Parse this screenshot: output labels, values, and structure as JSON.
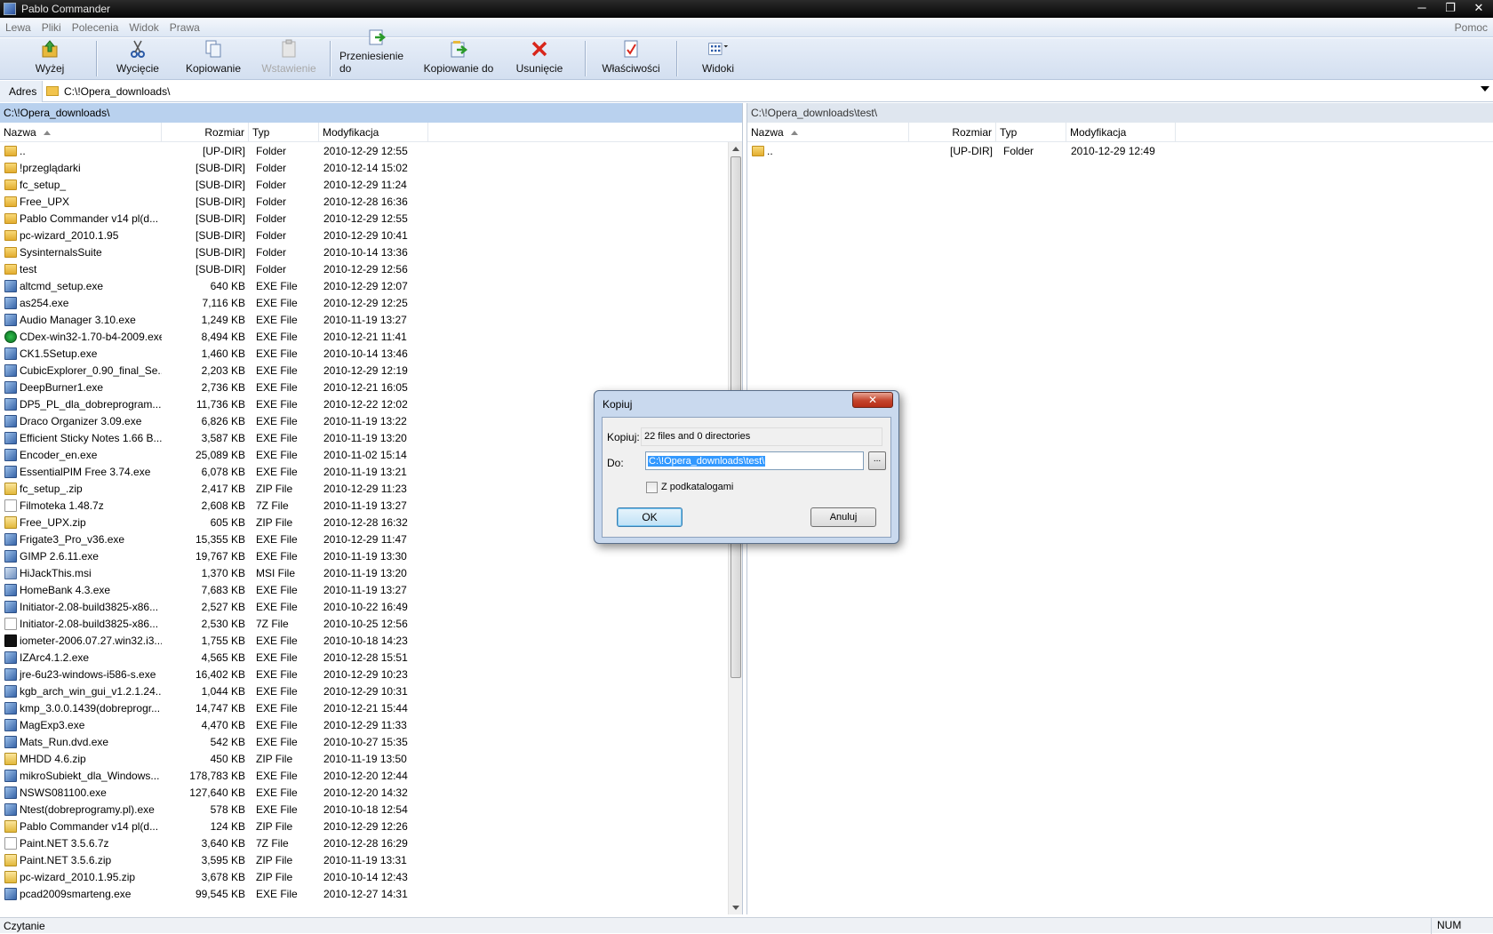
{
  "window": {
    "title": "Pablo Commander",
    "controls": [
      "─",
      "❐",
      "✕"
    ]
  },
  "menu": {
    "items": [
      "Lewa",
      "Pliki",
      "Polecenia",
      "Widok",
      "Prawa"
    ],
    "help": "Pomoc"
  },
  "toolbar": {
    "up": "Wyżej",
    "cut": "Wycięcie",
    "copy": "Kopiowanie",
    "paste": "Wstawienie",
    "move_to": "Przeniesienie do",
    "copy_to": "Kopiowanie do",
    "delete": "Usunięcie",
    "properties": "Właściwości",
    "views": "Widoki"
  },
  "address": {
    "label": "Adres",
    "value": "C:\\!Opera_downloads\\"
  },
  "left_panel": {
    "path": "C:\\!Opera_downloads\\",
    "columns": {
      "name": "Nazwa",
      "size": "Rozmiar",
      "type": "Typ",
      "modified": "Modyfikacja"
    },
    "rows": [
      {
        "icon": "folder",
        "name": "..",
        "size": "[UP-DIR]",
        "type": "Folder",
        "modified": "2010-12-29 12:55"
      },
      {
        "icon": "folder",
        "name": "!przeglądarki",
        "size": "[SUB-DIR]",
        "type": "Folder",
        "modified": "2010-12-14 15:02"
      },
      {
        "icon": "folder",
        "name": "fc_setup_",
        "size": "[SUB-DIR]",
        "type": "Folder",
        "modified": "2010-12-29 11:24"
      },
      {
        "icon": "folder",
        "name": "Free_UPX",
        "size": "[SUB-DIR]",
        "type": "Folder",
        "modified": "2010-12-28 16:36"
      },
      {
        "icon": "folder",
        "name": "Pablo Commander v14 pl(d...",
        "size": "[SUB-DIR]",
        "type": "Folder",
        "modified": "2010-12-29 12:55"
      },
      {
        "icon": "folder",
        "name": "pc-wizard_2010.1.95",
        "size": "[SUB-DIR]",
        "type": "Folder",
        "modified": "2010-12-29 10:41"
      },
      {
        "icon": "folder",
        "name": "SysinternalsSuite",
        "size": "[SUB-DIR]",
        "type": "Folder",
        "modified": "2010-10-14 13:36"
      },
      {
        "icon": "folder",
        "name": "test",
        "size": "[SUB-DIR]",
        "type": "Folder",
        "modified": "2010-12-29 12:56"
      },
      {
        "icon": "exe",
        "name": "altcmd_setup.exe",
        "size": "640 KB",
        "type": "EXE File",
        "modified": "2010-12-29 12:07"
      },
      {
        "icon": "exe",
        "name": "as254.exe",
        "size": "7,116 KB",
        "type": "EXE File",
        "modified": "2010-12-29 12:25"
      },
      {
        "icon": "exe",
        "name": "Audio Manager 3.10.exe",
        "size": "1,249 KB",
        "type": "EXE File",
        "modified": "2010-11-19 13:27"
      },
      {
        "icon": "green",
        "name": "CDex-win32-1.70-b4-2009.exe",
        "size": "8,494 KB",
        "type": "EXE File",
        "modified": "2010-12-21 11:41"
      },
      {
        "icon": "exe",
        "name": "CK1.5Setup.exe",
        "size": "1,460 KB",
        "type": "EXE File",
        "modified": "2010-10-14 13:46"
      },
      {
        "icon": "exe",
        "name": "CubicExplorer_0.90_final_Se...",
        "size": "2,203 KB",
        "type": "EXE File",
        "modified": "2010-12-29 12:19"
      },
      {
        "icon": "exe",
        "name": "DeepBurner1.exe",
        "size": "2,736 KB",
        "type": "EXE File",
        "modified": "2010-12-21 16:05"
      },
      {
        "icon": "exe",
        "name": "DP5_PL_dla_dobreprogram...",
        "size": "11,736 KB",
        "type": "EXE File",
        "modified": "2010-12-22 12:02"
      },
      {
        "icon": "exe",
        "name": "Draco Organizer 3.09.exe",
        "size": "6,826 KB",
        "type": "EXE File",
        "modified": "2010-11-19 13:22"
      },
      {
        "icon": "exe",
        "name": "Efficient Sticky Notes 1.66 B...",
        "size": "3,587 KB",
        "type": "EXE File",
        "modified": "2010-11-19 13:20"
      },
      {
        "icon": "exe",
        "name": "Encoder_en.exe",
        "size": "25,089 KB",
        "type": "EXE File",
        "modified": "2010-11-02 15:14"
      },
      {
        "icon": "exe",
        "name": "EssentialPIM Free 3.74.exe",
        "size": "6,078 KB",
        "type": "EXE File",
        "modified": "2010-11-19 13:21"
      },
      {
        "icon": "zip",
        "name": "fc_setup_.zip",
        "size": "2,417 KB",
        "type": "ZIP File",
        "modified": "2010-12-29 11:23"
      },
      {
        "icon": "file",
        "name": "Filmoteka 1.48.7z",
        "size": "2,608 KB",
        "type": "7Z File",
        "modified": "2010-11-19 13:27"
      },
      {
        "icon": "zip",
        "name": "Free_UPX.zip",
        "size": "605 KB",
        "type": "ZIP File",
        "modified": "2010-12-28 16:32"
      },
      {
        "icon": "exe",
        "name": "Frigate3_Pro_v36.exe",
        "size": "15,355 KB",
        "type": "EXE File",
        "modified": "2010-12-29 11:47"
      },
      {
        "icon": "exe",
        "name": "GIMP 2.6.11.exe",
        "size": "19,767 KB",
        "type": "EXE File",
        "modified": "2010-11-19 13:30"
      },
      {
        "icon": "msi",
        "name": "HiJackThis.msi",
        "size": "1,370 KB",
        "type": "MSI File",
        "modified": "2010-11-19 13:20"
      },
      {
        "icon": "exe",
        "name": "HomeBank 4.3.exe",
        "size": "7,683 KB",
        "type": "EXE File",
        "modified": "2010-11-19 13:27"
      },
      {
        "icon": "exe",
        "name": "Initiator-2.08-build3825-x86...",
        "size": "2,527 KB",
        "type": "EXE File",
        "modified": "2010-10-22 16:49"
      },
      {
        "icon": "file",
        "name": "Initiator-2.08-build3825-x86...",
        "size": "2,530 KB",
        "type": "7Z File",
        "modified": "2010-10-25 12:56"
      },
      {
        "icon": "dark",
        "name": "iometer-2006.07.27.win32.i3...",
        "size": "1,755 KB",
        "type": "EXE File",
        "modified": "2010-10-18 14:23"
      },
      {
        "icon": "exe",
        "name": "IZArc4.1.2.exe",
        "size": "4,565 KB",
        "type": "EXE File",
        "modified": "2010-12-28 15:51"
      },
      {
        "icon": "exe",
        "name": "jre-6u23-windows-i586-s.exe",
        "size": "16,402 KB",
        "type": "EXE File",
        "modified": "2010-12-29 10:23"
      },
      {
        "icon": "exe",
        "name": "kgb_arch_win_gui_v1.2.1.24...",
        "size": "1,044 KB",
        "type": "EXE File",
        "modified": "2010-12-29 10:31"
      },
      {
        "icon": "exe",
        "name": "kmp_3.0.0.1439(dobreprogr...",
        "size": "14,747 KB",
        "type": "EXE File",
        "modified": "2010-12-21 15:44"
      },
      {
        "icon": "exe",
        "name": "MagExp3.exe",
        "size": "4,470 KB",
        "type": "EXE File",
        "modified": "2010-12-29 11:33"
      },
      {
        "icon": "exe",
        "name": "Mats_Run.dvd.exe",
        "size": "542 KB",
        "type": "EXE File",
        "modified": "2010-10-27 15:35"
      },
      {
        "icon": "zip",
        "name": "MHDD 4.6.zip",
        "size": "450 KB",
        "type": "ZIP File",
        "modified": "2010-11-19 13:50"
      },
      {
        "icon": "exe",
        "name": "mikroSubiekt_dla_Windows...",
        "size": "178,783 KB",
        "type": "EXE File",
        "modified": "2010-12-20 12:44"
      },
      {
        "icon": "exe",
        "name": "NSWS081100.exe",
        "size": "127,640 KB",
        "type": "EXE File",
        "modified": "2010-12-20 14:32"
      },
      {
        "icon": "exe",
        "name": "Ntest(dobreprogramy.pl).exe",
        "size": "578 KB",
        "type": "EXE File",
        "modified": "2010-10-18 12:54"
      },
      {
        "icon": "zip",
        "name": "Pablo Commander v14 pl(d...",
        "size": "124 KB",
        "type": "ZIP File",
        "modified": "2010-12-29 12:26"
      },
      {
        "icon": "file",
        "name": "Paint.NET 3.5.6.7z",
        "size": "3,640 KB",
        "type": "7Z File",
        "modified": "2010-12-28 16:29"
      },
      {
        "icon": "zip",
        "name": "Paint.NET 3.5.6.zip",
        "size": "3,595 KB",
        "type": "ZIP File",
        "modified": "2010-11-19 13:31"
      },
      {
        "icon": "zip",
        "name": "pc-wizard_2010.1.95.zip",
        "size": "3,678 KB",
        "type": "ZIP File",
        "modified": "2010-10-14 12:43"
      },
      {
        "icon": "exe",
        "name": "pcad2009smarteng.exe",
        "size": "99,545 KB",
        "type": "EXE File",
        "modified": "2010-12-27 14:31"
      }
    ]
  },
  "right_panel": {
    "path": "C:\\!Opera_downloads\\test\\",
    "columns": {
      "name": "Nazwa",
      "size": "Rozmiar",
      "type": "Typ",
      "modified": "Modyfikacja"
    },
    "rows": [
      {
        "icon": "folder",
        "name": "..",
        "size": "[UP-DIR]",
        "type": "Folder",
        "modified": "2010-12-29 12:49"
      }
    ]
  },
  "dialog": {
    "title": "Kopiuj",
    "close": "✕",
    "copy_label": "Kopiuj:",
    "copy_value": "22 files and 0 directories",
    "dest_label": "Do:",
    "dest_value": "C:\\!Opera_downloads\\test\\",
    "browse": "...",
    "subdirs_label": "Z podkatalogami",
    "subdirs_checked": false,
    "ok": "OK",
    "cancel": "Anuluj"
  },
  "status": {
    "text": "Czytanie",
    "num": "NUM"
  },
  "colors": {
    "selected_panel": "#b9d1ee",
    "inactive_panel": "#dfe6ef",
    "toolbar": "#d3dff0",
    "dialog_frame": "#c9d9ee",
    "close_button": "#c4442c"
  }
}
